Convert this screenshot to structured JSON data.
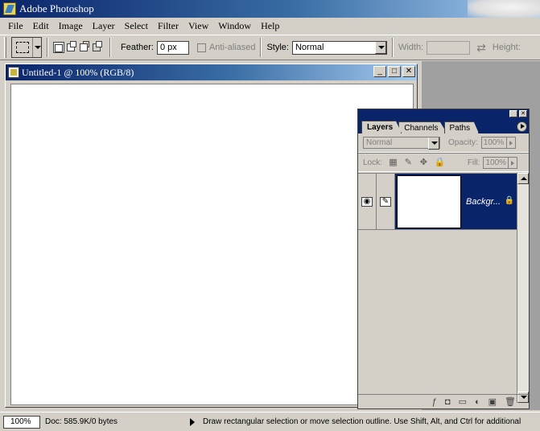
{
  "app": {
    "title": "Adobe Photoshop"
  },
  "menu": [
    "File",
    "Edit",
    "Image",
    "Layer",
    "Select",
    "Filter",
    "View",
    "Window",
    "Help"
  ],
  "options": {
    "feather_label": "Feather:",
    "feather_value": "0 px",
    "antialiased_label": "Anti-aliased",
    "style_label": "Style:",
    "style_value": "Normal",
    "width_label": "Width:",
    "height_label": "Height:"
  },
  "document": {
    "title": "Untitled-1 @ 100% (RGB/8)",
    "minimize": "_",
    "maximize": "□",
    "close": "✕"
  },
  "layers_panel": {
    "tabs": [
      "Layers",
      "Channels",
      "Paths"
    ],
    "blend_mode": "Normal",
    "opacity_label": "Opacity:",
    "opacity_value": "100%",
    "lock_label": "Lock:",
    "fill_label": "Fill:",
    "fill_value": "100%",
    "layers": [
      {
        "name": "Backgr..."
      }
    ]
  },
  "status": {
    "zoom": "100%",
    "doc_info": "Doc: 585.9K/0 bytes",
    "message": "Draw rectangular selection or move selection outline.  Use Shift, Alt, and Ctrl for additional"
  }
}
